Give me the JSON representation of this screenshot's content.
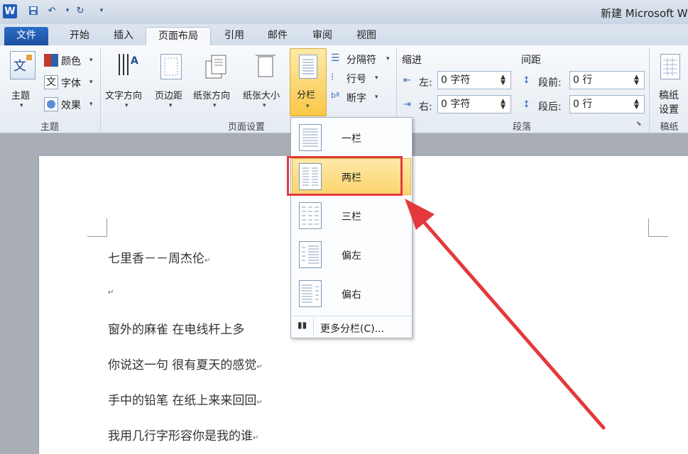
{
  "app": {
    "logo": "W",
    "title": "新建 Microsoft W"
  },
  "quick_access": {
    "save_icon": "save-icon",
    "undo": "↶",
    "redo": "↻",
    "dropdown": "▾"
  },
  "tabs": [
    "文件",
    "开始",
    "插入",
    "页面布局",
    "引用",
    "邮件",
    "审阅",
    "视图"
  ],
  "ribbon": {
    "theme": {
      "label": "主题",
      "colors": "颜色",
      "fonts": "字体",
      "effects": "效果",
      "group": "主题"
    },
    "page_setup": {
      "text_direction": "文字方向",
      "margins": "页边距",
      "orientation": "纸张方向",
      "size": "纸张大小",
      "columns": "分栏",
      "breaks": "分隔符",
      "line_numbers": "行号",
      "hyphenation": "断字",
      "group": "页面设置"
    },
    "paragraph": {
      "indent_title": "缩进",
      "left_label": "左:",
      "left_value": "0 字符",
      "right_label": "右:",
      "right_value": "0 字符",
      "spacing_title": "间距",
      "before_label": "段前:",
      "before_value": "0 行",
      "after_label": "段后:",
      "after_value": "0 行",
      "group": "段落"
    },
    "manuscript": {
      "label1": "稿纸",
      "label2": "设置",
      "group": "稿纸"
    }
  },
  "columns_menu": {
    "options": [
      "一栏",
      "两栏",
      "三栏",
      "偏左",
      "偏右"
    ],
    "selected": "两栏",
    "more": "更多分栏(C)..."
  },
  "document": {
    "lines": [
      "七里香－－周杰伦",
      "",
      "窗外的麻雀 在电线杆上多",
      "你说这一句 很有夏天的感觉",
      "手中的铅笔 在纸上来来回回",
      "我用几行字形容你是我的谁"
    ],
    "para_mark": "↵"
  },
  "colors": {
    "highlight": "#e4393c",
    "accent": "#fcd46d"
  }
}
